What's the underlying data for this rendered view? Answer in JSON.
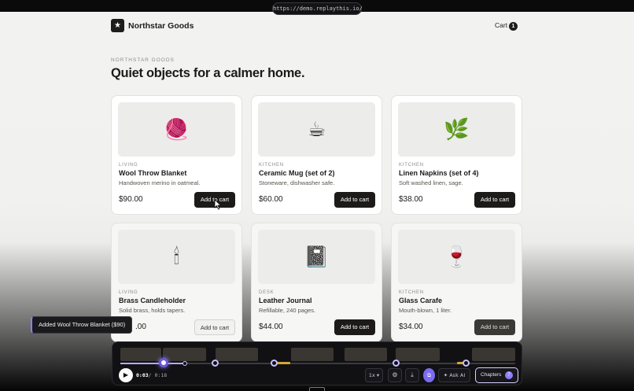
{
  "browser": {
    "url": "https://demo.replaythis.io/"
  },
  "header": {
    "brand": "Northstar Goods",
    "logo_icon": "★",
    "cart_label": "Cart",
    "cart_count": "1"
  },
  "hero": {
    "eyebrow": "NORTHSTAR GOODS",
    "title": "Quiet objects for a calmer home."
  },
  "products": [
    {
      "category": "LIVING",
      "name": "Wool Throw Blanket",
      "description": "Handwoven merino in oatmeal.",
      "price": "$90.00",
      "button": "Add to cart",
      "icon": "🧶"
    },
    {
      "category": "KITCHEN",
      "name": "Ceramic Mug (set of 2)",
      "description": "Stoneware, dishwasher safe.",
      "price": "$60.00",
      "button": "Add to cart",
      "icon": "☕"
    },
    {
      "category": "KITCHEN",
      "name": "Linen Napkins (set of 4)",
      "description": "Soft washed linen, sage.",
      "price": "$38.00",
      "button": "Add to cart",
      "icon": "🌿"
    },
    {
      "category": "LIVING",
      "name": "Brass Candleholder",
      "description": "Solid brass, holds tapers.",
      "price": ".00",
      "button": "Add to cart",
      "icon": "🕯"
    },
    {
      "category": "DESK",
      "name": "Leather Journal",
      "description": "Refillable, 240 pages.",
      "price": "$44.00",
      "button": "Add to cart",
      "icon": "📓"
    },
    {
      "category": "KITCHEN",
      "name": "Glass Carafe",
      "description": "Mouth-blown, 1 liter.",
      "price": "$34.00",
      "button": "Add to cart",
      "icon": "🍷"
    }
  ],
  "toast": {
    "message": "Added Wool Throw Blanket ($90)"
  },
  "player": {
    "current_time": "0:03",
    "separator": "/",
    "duration": "0:18",
    "speed": "1x",
    "ask_ai": "✦ Ask AI",
    "chapters": "Chapters",
    "chapters_count": "7",
    "colors": {
      "accent": "#8e7dff",
      "highlight": "#d4a63c"
    }
  }
}
